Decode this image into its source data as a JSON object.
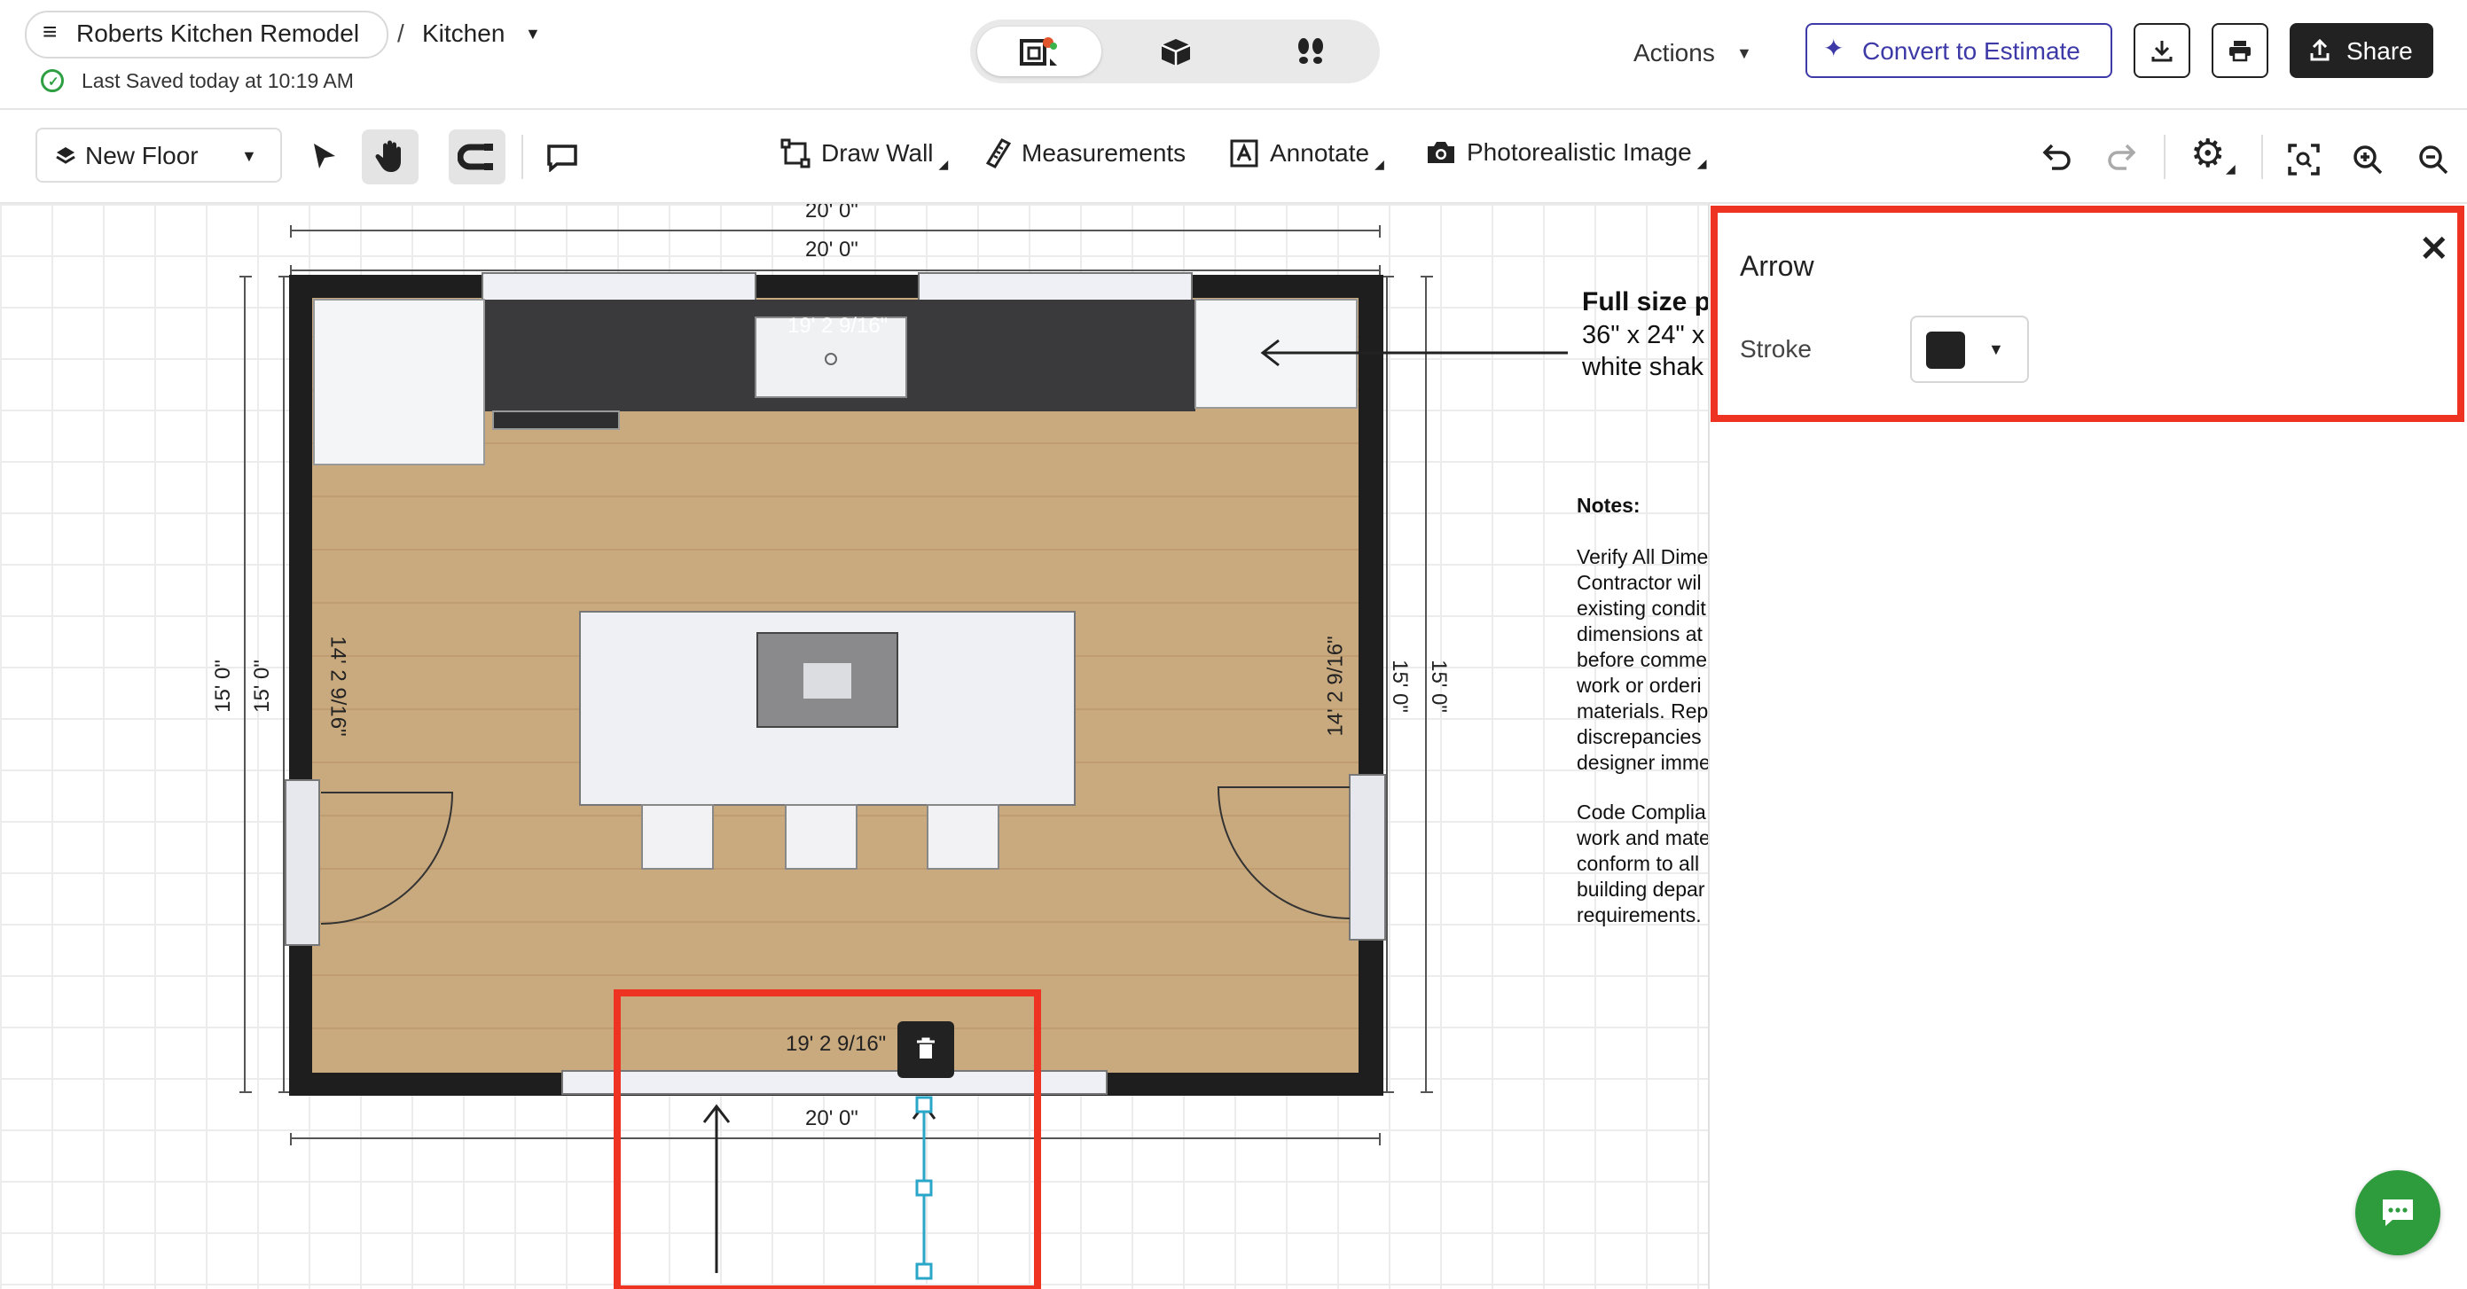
{
  "header": {
    "project_name": "Roberts Kitchen Remodel",
    "separator": "/",
    "room": "Kitchen",
    "saved_status": "Last Saved today at 10:19 AM",
    "view_modes": [
      "2d-floorplan-icon",
      "3d-box-icon",
      "walkthrough-footsteps-icon"
    ],
    "actions_label": "Actions",
    "convert_label": "Convert to Estimate",
    "share_label": "Share",
    "accent_color": "#3d3aa8"
  },
  "toolbar": {
    "floor_select": "New Floor",
    "draw_wall": "Draw Wall",
    "measurements": "Measurements",
    "annotate": "Annotate",
    "photo_image": "Photorealistic Image"
  },
  "plan": {
    "top_dim_outer": "20' 0\"",
    "top_dim_inner": "20' 0\"",
    "counter_dim": "19' 2 9/16\"",
    "bottom_sel_dim": "19' 2 9/16\"",
    "bottom_dim": "20' 0\"",
    "left_dim_outer": "15' 0\"",
    "left_dim_inner": "15' 0\"",
    "left_wall_dim": "14' 2 9/16\"",
    "right_wall_dim": "14' 2 9/16\"",
    "right_dim_inner": "15' 0\"",
    "right_dim_outer": "15' 0\"",
    "wall_color": "#1e1e1e",
    "floor_color": "#c9a97e",
    "selection_color": "#ee3322"
  },
  "annotation": {
    "title": "Full size p",
    "line1": "36\" x 24\" x",
    "line2": "white shak",
    "notes_heading": "Notes:",
    "notes_p1": [
      "Verify All Dime",
      "Contractor wil",
      "existing condit",
      "dimensions at",
      "before comme",
      "work or orderi",
      "materials. Rep",
      "discrepancies",
      "designer imme"
    ],
    "notes_p2": [
      "Code Complia",
      "work and mate",
      "conform to all",
      "building depar",
      "requirements."
    ]
  },
  "panel": {
    "title": "Arrow",
    "stroke_label": "Stroke",
    "stroke_color": "#222222"
  }
}
